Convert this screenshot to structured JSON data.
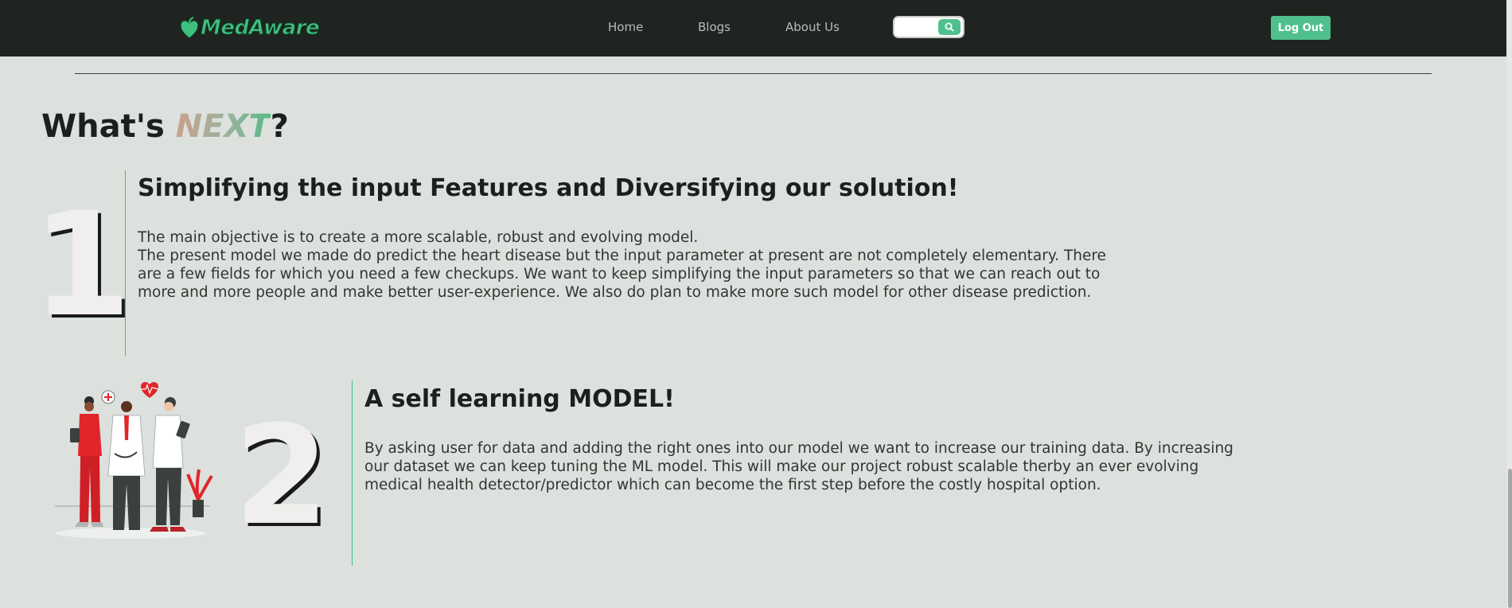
{
  "navbar": {
    "brand": "MedAware",
    "links": [
      "Home",
      "Blogs",
      "About Us"
    ],
    "search": {
      "placeholder": "",
      "icon": "search-icon"
    },
    "logout_label": "Log Out",
    "accent": "#4fc08d"
  },
  "heading": {
    "prefix": "What's ",
    "highlight": "NEXT",
    "suffix": "?"
  },
  "sections": [
    {
      "number": "1",
      "title": "Simplifying the input Features and Diversifying our solution!",
      "paragraph_1": "The main objective is to create a more scalable, robust and evolving model.",
      "paragraph_2": "The present model we made do predict the heart disease but the input parameter at present are not completely elementary. There are a few fields for which you need a few checkups. We want to keep simplifying the input parameters so that we can reach out to more and more people and make better user-experience. We also do plan to make more such model for other disease prediction."
    },
    {
      "number": "2",
      "title": "A self learning MODEL!",
      "paragraph_1": "By asking user for data and adding the right ones into our model we want to increase our training data. By increasing our dataset we can keep tuning the ML model. This will make our project robust scalable therby an ever evolving medical health detector/predictor which can become the first step before the costly hospital option."
    }
  ]
}
